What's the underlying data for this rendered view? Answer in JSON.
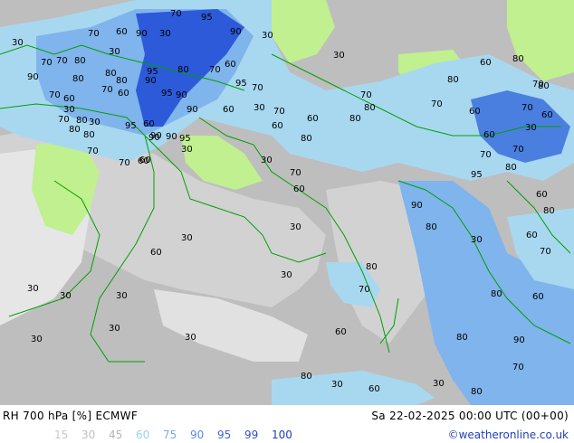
{
  "map": {
    "colors": {
      "sea": "#bebebe",
      "land_dry": "#d2d2d2",
      "light_gray": "#e6e6e6",
      "rh_60": "#a8d8f0",
      "rh_75": "#7fb4ec",
      "rh_90": "#4a7fe0",
      "rh_95": "#2c5ad8",
      "green_low": "#c0f090",
      "border": "#00a000",
      "coast": "#00a000"
    },
    "contour_labels": [
      {
        "text": "70"
      },
      {
        "text": "95"
      },
      {
        "text": "70"
      },
      {
        "text": "30"
      },
      {
        "text": "90"
      },
      {
        "text": "30"
      },
      {
        "text": "30"
      },
      {
        "text": "60"
      },
      {
        "text": "90"
      },
      {
        "text": "30"
      },
      {
        "text": "70"
      },
      {
        "text": "80"
      },
      {
        "text": "70"
      },
      {
        "text": "80"
      },
      {
        "text": "95"
      },
      {
        "text": "80"
      },
      {
        "text": "70"
      },
      {
        "text": "60"
      },
      {
        "text": "90"
      },
      {
        "text": "80"
      },
      {
        "text": "90"
      },
      {
        "text": "80"
      },
      {
        "text": "95"
      },
      {
        "text": "70"
      },
      {
        "text": "70"
      },
      {
        "text": "60"
      },
      {
        "text": "95"
      },
      {
        "text": "90"
      },
      {
        "text": "90"
      },
      {
        "text": "30"
      },
      {
        "text": "60"
      },
      {
        "text": "30"
      },
      {
        "text": "90"
      },
      {
        "text": "60"
      },
      {
        "text": "70"
      },
      {
        "text": "60"
      },
      {
        "text": "70"
      },
      {
        "text": "80"
      },
      {
        "text": "95"
      },
      {
        "text": "90"
      },
      {
        "text": "60"
      },
      {
        "text": "70"
      },
      {
        "text": "80"
      },
      {
        "text": "80"
      },
      {
        "text": "90"
      },
      {
        "text": "95"
      },
      {
        "text": "30"
      },
      {
        "text": "70"
      },
      {
        "text": "80"
      },
      {
        "text": "70"
      },
      {
        "text": "60"
      },
      {
        "text": "30"
      },
      {
        "text": "70"
      },
      {
        "text": "60"
      },
      {
        "text": "60"
      },
      {
        "text": "80"
      },
      {
        "text": "70"
      },
      {
        "text": "80"
      },
      {
        "text": "60"
      },
      {
        "text": "30"
      },
      {
        "text": "30"
      },
      {
        "text": "30"
      },
      {
        "text": "30"
      },
      {
        "text": "60"
      },
      {
        "text": "30"
      },
      {
        "text": "80"
      },
      {
        "text": "70"
      },
      {
        "text": "30"
      },
      {
        "text": "30"
      },
      {
        "text": "30"
      },
      {
        "text": "30"
      },
      {
        "text": "30"
      },
      {
        "text": "30"
      },
      {
        "text": "60"
      },
      {
        "text": "80"
      },
      {
        "text": "30"
      },
      {
        "text": "60"
      },
      {
        "text": "30"
      },
      {
        "text": "80"
      },
      {
        "text": "70"
      },
      {
        "text": "80"
      },
      {
        "text": "90"
      },
      {
        "text": "80"
      },
      {
        "text": "60"
      },
      {
        "text": "70"
      },
      {
        "text": "80"
      },
      {
        "text": "60"
      },
      {
        "text": "30"
      },
      {
        "text": "80"
      },
      {
        "text": "90"
      },
      {
        "text": "95"
      },
      {
        "text": "80"
      },
      {
        "text": "60"
      },
      {
        "text": "70"
      },
      {
        "text": "70"
      },
      {
        "text": "60"
      },
      {
        "text": "30"
      },
      {
        "text": "60"
      },
      {
        "text": "70"
      },
      {
        "text": "60"
      },
      {
        "text": "70"
      },
      {
        "text": "80"
      },
      {
        "text": "60"
      },
      {
        "text": "80"
      },
      {
        "text": "80"
      },
      {
        "text": "70"
      }
    ]
  },
  "footer": {
    "title": "RH 700 hPa [%] ECMWF",
    "datetime": "Sa 22-02-2025 00:00 UTC (00+00)",
    "credit": "©weatheronline.co.uk",
    "legend": [
      {
        "label": "15",
        "color": "#c8c8c8"
      },
      {
        "label": "30",
        "color": "#c0c0c0"
      },
      {
        "label": "45",
        "color": "#b4b4b4"
      },
      {
        "label": "60",
        "color": "#96d0f4"
      },
      {
        "label": "75",
        "color": "#78aaf0"
      },
      {
        "label": "90",
        "color": "#5a8ae8"
      },
      {
        "label": "95",
        "color": "#3c68dc"
      },
      {
        "label": "99",
        "color": "#2c50d0"
      },
      {
        "label": "100",
        "color": "#1e3cc4"
      }
    ]
  }
}
